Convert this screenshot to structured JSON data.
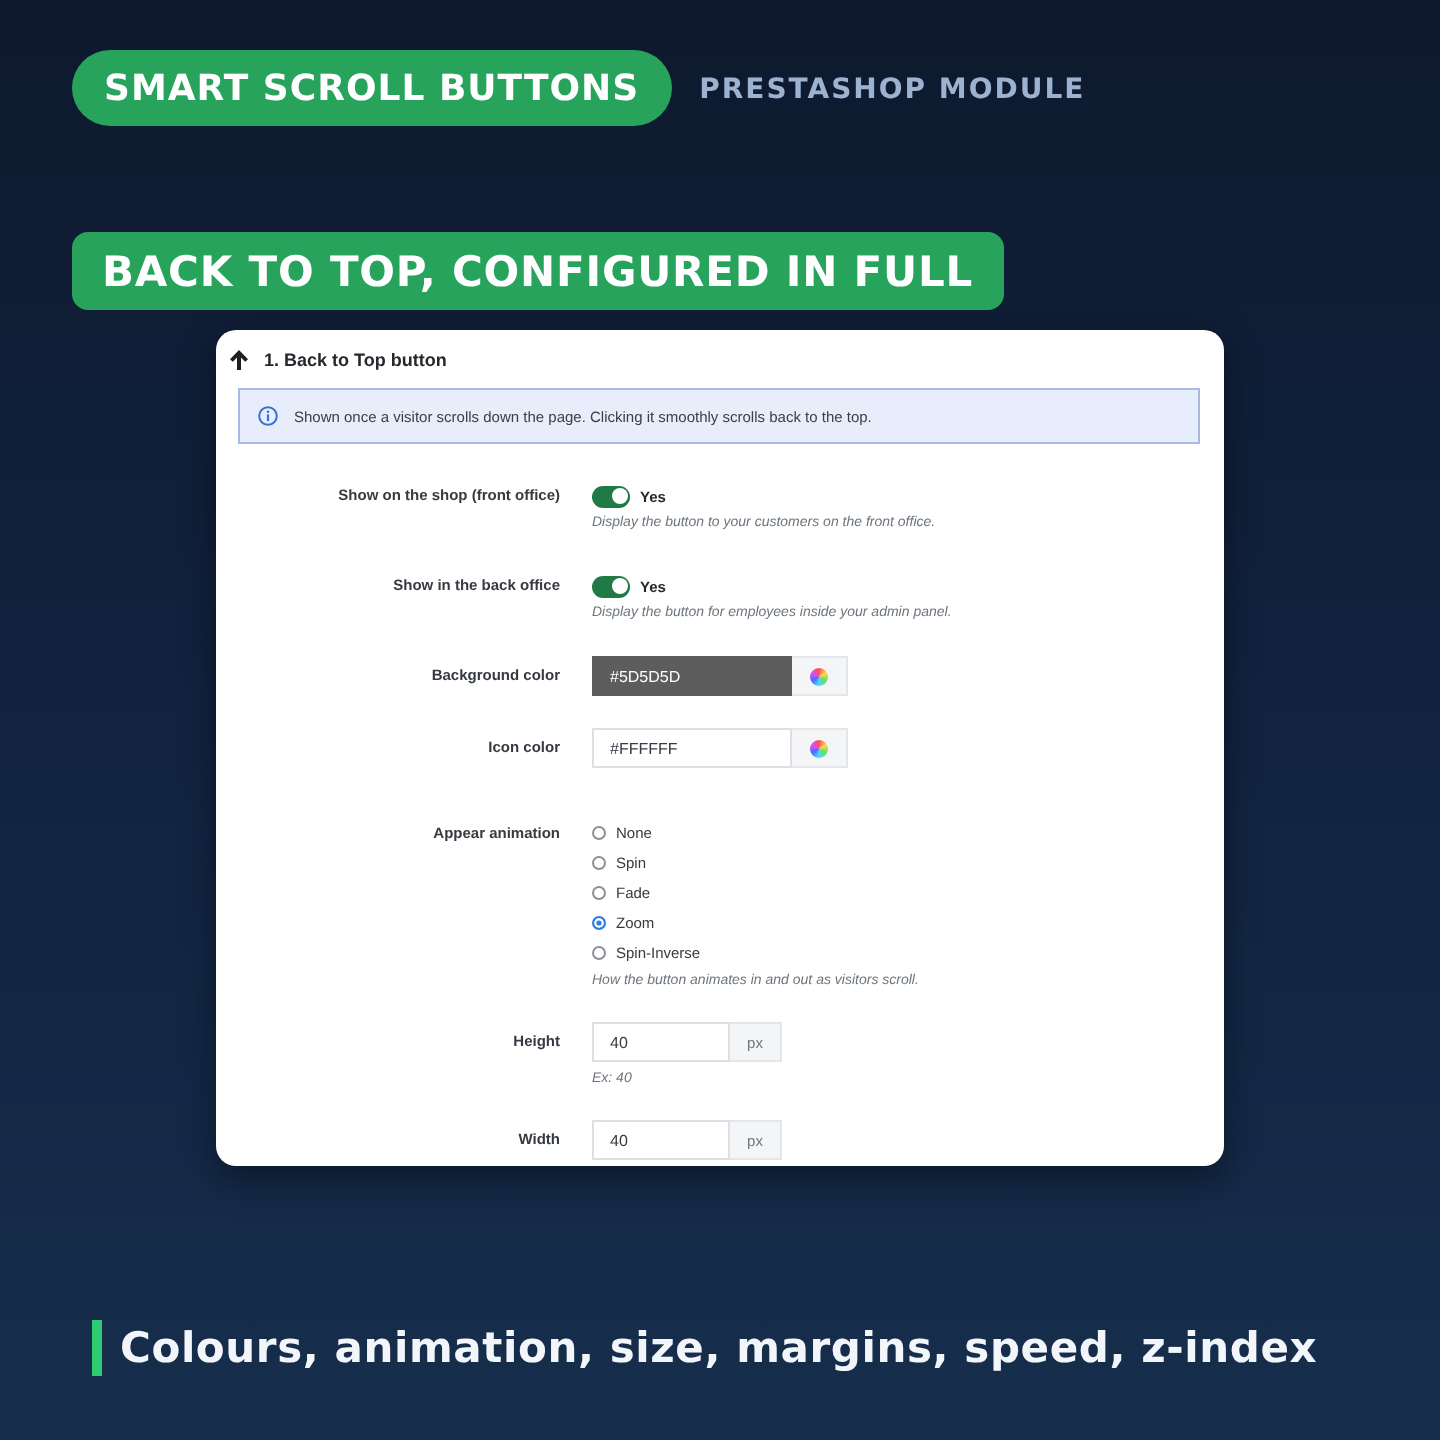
{
  "header": {
    "badge": "SMART SCROLL BUTTONS",
    "subtitle": "PRESTASHOP MODULE"
  },
  "headline": "BACK TO TOP, CONFIGURED IN FULL",
  "panel": {
    "title": "1. Back to Top button",
    "info": "Shown once a visitor scrolls down the page. Clicking it smoothly scrolls back to the top.",
    "fields": [
      {
        "kind": "toggle",
        "label": "Show on the shop (front office)",
        "on": true,
        "value": "Yes",
        "hint": "Display the button to your customers on the front office."
      },
      {
        "kind": "toggle",
        "label": "Show in the back office",
        "on": true,
        "value": "Yes",
        "hint": "Display the button for employees inside your admin panel."
      },
      {
        "kind": "color",
        "label": "Background color",
        "value": "#5D5D5D",
        "color": "#5d5d5d"
      },
      {
        "kind": "color",
        "label": "Icon color",
        "value": "#FFFFFF",
        "color": "#ffffff"
      },
      {
        "kind": "radio",
        "label": "Appear animation",
        "options": [
          {
            "label": "None",
            "selected": false
          },
          {
            "label": "Spin",
            "selected": false
          },
          {
            "label": "Fade",
            "selected": false
          },
          {
            "label": "Zoom",
            "selected": true
          },
          {
            "label": "Spin-Inverse",
            "selected": false
          }
        ],
        "hint": "How the button animates in and out as visitors scroll."
      },
      {
        "kind": "number",
        "label": "Height",
        "value": "40",
        "unit": "px",
        "hint": "Ex: 40"
      },
      {
        "kind": "number",
        "label": "Width",
        "value": "40",
        "unit": "px"
      }
    ]
  },
  "footer": {
    "caption": "Colours, animation, size, margins, speed, z-index"
  }
}
